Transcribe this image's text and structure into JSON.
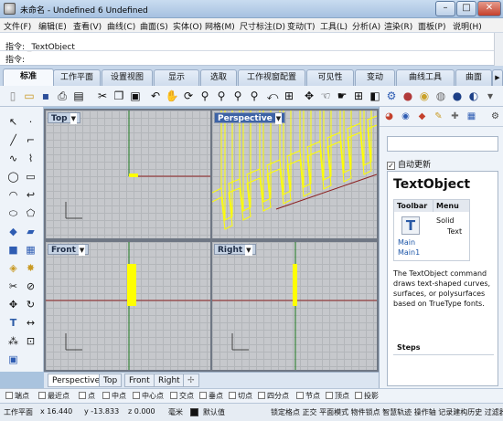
{
  "window": {
    "title": "未命名 - Undefined 6 Undefined"
  },
  "menu": [
    "文件(F)",
    "编辑(E)",
    "查看(V)",
    "曲线(C)",
    "曲面(S)",
    "实体(O)",
    "网格(M)",
    "尺寸标注(D)",
    "变动(T)",
    "工具(L)",
    "分析(A)",
    "渲染(R)",
    "面板(P)",
    "说明(H)"
  ],
  "command": {
    "history": "指令: _TextObject",
    "prompt": "指令:"
  },
  "tabs": [
    "标准",
    "工作平面",
    "设置视图",
    "显示",
    "选取",
    "工作视窗配置",
    "可见性",
    "变动",
    "曲线工具",
    "曲面"
  ],
  "viewports": {
    "top": "Top",
    "perspective": "Perspective",
    "front": "Front",
    "right": "Right"
  },
  "viewport_tabs": [
    "Perspective",
    "Top",
    "Front",
    "Right"
  ],
  "panel": {
    "auto_update": "自动更新",
    "help_title": "TextObject",
    "toolbar_header": "Toolbar",
    "menu_header": "Menu",
    "menu_item_1": "Solid",
    "menu_item_2": "Text",
    "link_main": "Main",
    "link_main1": "Main1",
    "description": "The TextObject command draws text-shaped curves, surfaces, or polysurfaces based on TrueType fonts.",
    "steps": "Steps"
  },
  "osnaps": [
    "端点",
    "最近点",
    "点",
    "中点",
    "中心点",
    "交点",
    "垂点",
    "切点",
    "四分点",
    "节点",
    "顶点",
    "投影"
  ],
  "status": {
    "cplane": "工作平面",
    "x": "x 16.440",
    "y": "y -13.833",
    "z": "z 0.000",
    "unit": "毫米",
    "layer": "默认值",
    "modes": "锁定格点 正交 平面模式 物件锁点 智慧轨迹 操作轴 记录建构历史 过滤器"
  },
  "colors": {
    "accent": "#3d63a6",
    "selection": "#ffff00",
    "x_axis": "#8b1e1e",
    "y_axis": "#1f7a1f"
  },
  "icons": [
    "rhino-app-icon",
    "new-file-icon",
    "open-icon",
    "save-icon",
    "print-icon",
    "cut-icon",
    "copy-icon",
    "paste-icon",
    "undo-icon",
    "pan-icon",
    "rotate-view-icon",
    "zoom-icon",
    "zoom-window-icon",
    "zoom-extents-icon",
    "four-view-icon",
    "grid-icon",
    "gear-icon",
    "light-icon",
    "sphere-icon"
  ]
}
